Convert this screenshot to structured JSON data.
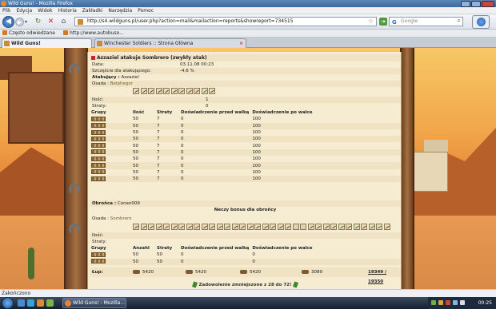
{
  "window": {
    "title": "Wild Guns! - Mozilla Firefox"
  },
  "menu": [
    "Plik",
    "Edycja",
    "Widok",
    "Historia",
    "Zakładki",
    "Narzędzia",
    "Pomoc"
  ],
  "nav": {
    "url": "http://s4.wildguns.pl/user.php?action=mail&mailaction=reports&showreport=734515",
    "search_placeholder": "Google"
  },
  "bookmarks": [
    "Często odwiedzane",
    "http://www.autobuso..."
  ],
  "tabs": [
    {
      "label": "Wild Guns!",
      "active": true
    },
    {
      "label": "Winchester Soldiers :: Strona Główna",
      "active": false
    }
  ],
  "report": {
    "title": "Azzaziel atakuje Sombrero (zwykły atak)",
    "date_label": "Data:",
    "date_value": "03.11.08 00:23",
    "luck_label": "Szczęście dla atakującego:",
    "luck_value": "-4.6 %",
    "attacker_label": "Atakujący :",
    "attacker_name": "Azzaziel",
    "attacker_settlement_label": "Osada :",
    "attacker_settlement": "Belphegor",
    "units_label": "Ilość:",
    "losses_label": "Straty:",
    "attacker_units_value": "1",
    "attacker_losses_value": "0",
    "groups_headers": [
      "Grupy",
      "Ilość",
      "Straty",
      "Doświadczenie przed walką",
      "Doświadczenie po walce"
    ],
    "attacker_groups": [
      [
        "50",
        "7",
        "0",
        "100"
      ],
      [
        "50",
        "7",
        "0",
        "100"
      ],
      [
        "50",
        "7",
        "0",
        "100"
      ],
      [
        "50",
        "7",
        "0",
        "100"
      ],
      [
        "50",
        "7",
        "0",
        "100"
      ],
      [
        "50",
        "7",
        "0",
        "100"
      ],
      [
        "50",
        "7",
        "0",
        "100"
      ],
      [
        "50",
        "7",
        "0",
        "100"
      ],
      [
        "50",
        "7",
        "0",
        "100"
      ],
      [
        "50",
        "7",
        "0",
        "100"
      ]
    ],
    "defender_label": "Obrońca :",
    "defender_name": "Conan009",
    "no_bonus": "Neczy bonus dla obrońcy",
    "defender_settlement_label": "Osada :",
    "defender_settlement": "Sombrero",
    "defender_groups_headers": [
      "Grupy",
      "Anzahl",
      "Straty",
      "Doświadczenie przed walką",
      "Doświadczenie po walce"
    ],
    "defender_groups": [
      [
        "50",
        "50",
        "0",
        "0"
      ],
      [
        "50",
        "50",
        "0",
        "0"
      ]
    ],
    "loot_label": "Łup:",
    "loot": [
      "5420",
      "5420",
      "5420",
      "3089"
    ],
    "loot_total": "19349 / 19350",
    "satisfaction": "Zadowolenie zmniejszone z 28 do 72!"
  },
  "status": "Zakończono",
  "taskbar": {
    "task_label": "Wild Guns! - Mozilla...",
    "clock": "00:25"
  }
}
